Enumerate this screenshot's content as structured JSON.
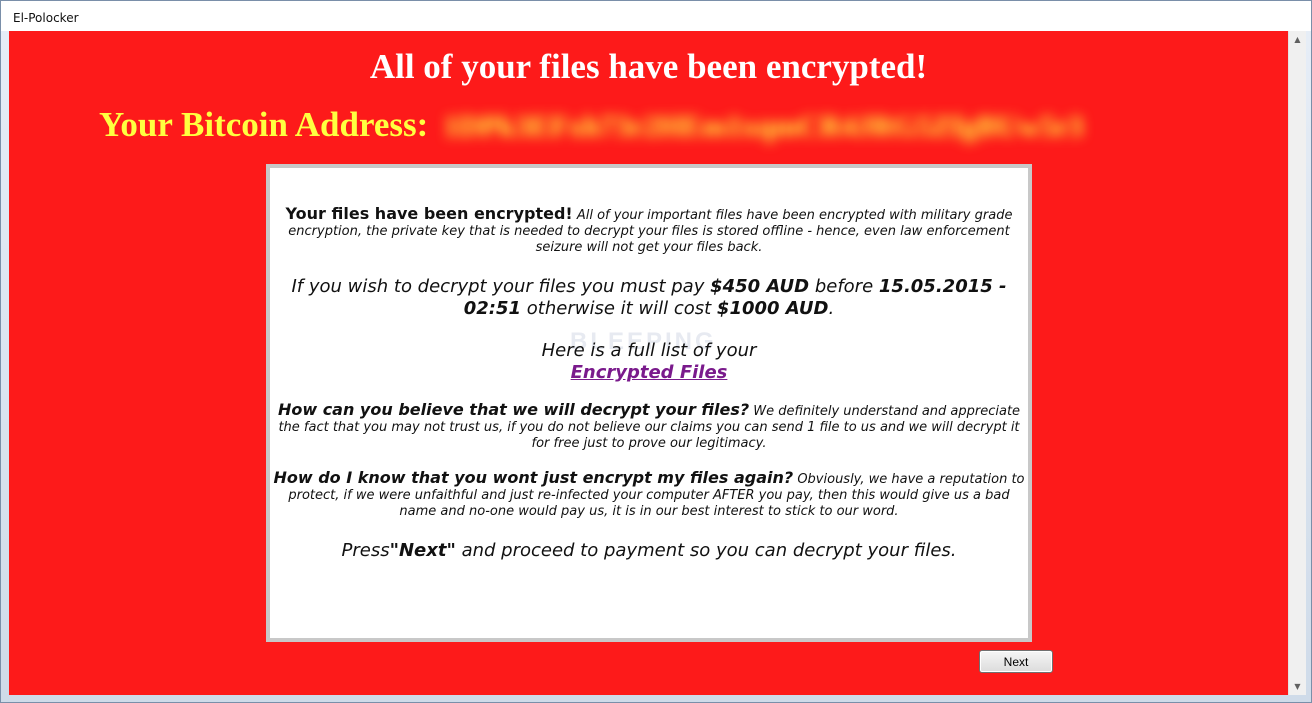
{
  "window": {
    "title": "El-Polocker"
  },
  "header": {
    "title": "All of your files have been encrypted!",
    "bitcoin_label": "Your Bitcoin Address:",
    "bitcoin_address": "1DPk3EFxh73r2HEm1xqmCR4JRG5ZfgBUw5r3"
  },
  "note": {
    "p1_lead": "Your files have been encrypted!",
    "p1_body": " All of your important files have been encrypted with military grade encryption, the private key that is needed to decrypt your files is stored offline - hence, even law enforcement seizure will not get your files back.",
    "p2_a": "If you wish to decrypt your files you must pay ",
    "p2_amount": "$450 AUD",
    "p2_b": " before ",
    "p2_deadline": "15.05.2015 - 02:51",
    "p2_c": " otherwise it will cost ",
    "p2_amount_late": "$1000 AUD",
    "p2_d": ".",
    "p3_text": "Here is a full list of your",
    "p3_link": "Encrypted Files",
    "p4_question": "How can you believe that we will decrypt your files?",
    "p4_body": " We definitely understand and appreciate the fact that you may not trust us, if you do not believe our claims you can send 1 file to us and we will decrypt it for free just to prove our legitimacy.",
    "p5_question": "How do I know that you wont just encrypt my files again?",
    "p5_body": " Obviously, we have a reputation to protect, if we were unfaithful and just re-infected your computer AFTER you pay, then this would give us a bad name and no-one would pay us, it is in our best interest to stick to our word.",
    "p6_a": "Press",
    "p6_next": "\"Next\"",
    "p6_b": " and proceed to payment so you can decrypt your files.",
    "watermark": "BLEEPING"
  },
  "footer": {
    "next_label": "Next"
  },
  "colors": {
    "background": "#fd1a1a",
    "title": "#ffffff",
    "bitcoin_label": "#ffff40",
    "link": "#7a1a8c"
  }
}
